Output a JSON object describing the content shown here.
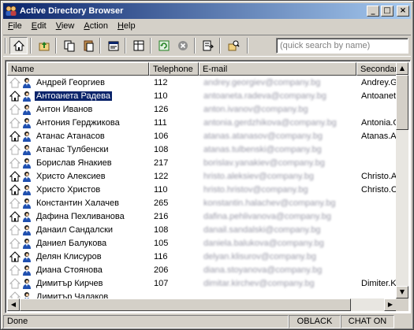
{
  "window": {
    "title": "Active Directory Browser"
  },
  "menu": [
    {
      "label": "File",
      "key": "F",
      "rest": "ile"
    },
    {
      "label": "Edit",
      "key": "E",
      "rest": "dit"
    },
    {
      "label": "View",
      "key": "V",
      "rest": "iew"
    },
    {
      "label": "Action",
      "key": "A",
      "rest": "ction"
    },
    {
      "label": "Help",
      "key": "H",
      "rest": "elp"
    }
  ],
  "toolbar": {
    "buttons": [
      "home-icon",
      "up-folder-icon",
      "copy-icon",
      "paste-icon",
      "properties-icon",
      "details-view-icon",
      "refresh-icon",
      "stop-icon",
      "export-icon",
      "filter-icon"
    ],
    "search_placeholder": "(quick search by name)"
  },
  "columns": {
    "name": "Name",
    "telephone": "Telephone",
    "email": "E-mail",
    "secondary": "Secondar"
  },
  "rows": [
    {
      "home": false,
      "name": "Андрей Георгиев",
      "tel": "112",
      "email": "andrey.georgiev@company.bg",
      "sec": "Andrey.G"
    },
    {
      "home": true,
      "name": "Антоанета Радева",
      "tel": "110",
      "email": "antoaneta.radeva@company.bg",
      "sec": "Antoaneta",
      "selected": true
    },
    {
      "home": false,
      "name": "Антон Иванов",
      "tel": "126",
      "email": "anton.ivanov@company.bg",
      "sec": ""
    },
    {
      "home": false,
      "name": "Антония Герджикова",
      "tel": "111",
      "email": "antonia.gerdzhikova@company.bg",
      "sec": "Antonia.G"
    },
    {
      "home": true,
      "name": "Атанас Атанасов",
      "tel": "106",
      "email": "atanas.atanasov@company.bg",
      "sec": "Atanas.A"
    },
    {
      "home": false,
      "name": "Атанас Тулбенски",
      "tel": "108",
      "email": "atanas.tulbenski@company.bg",
      "sec": ""
    },
    {
      "home": false,
      "name": "Борислав Янакиев",
      "tel": "217",
      "email": "borislav.yanakiev@company.bg",
      "sec": ""
    },
    {
      "home": true,
      "name": "Христо Алексиев",
      "tel": "122",
      "email": "hristo.aleksiev@company.bg",
      "sec": "Christo.Al"
    },
    {
      "home": true,
      "name": "Христо Христов",
      "tel": "110",
      "email": "hristo.hristov@company.bg",
      "sec": "Christo.Cl"
    },
    {
      "home": false,
      "name": "Константин Халачев",
      "tel": "265",
      "email": "konstantin.halachev@company.bg",
      "sec": ""
    },
    {
      "home": true,
      "name": "Дафина Пехливанова",
      "tel": "216",
      "email": "dafina.pehlivanova@company.bg",
      "sec": ""
    },
    {
      "home": false,
      "name": "Данаил Сандалски",
      "tel": "108",
      "email": "danail.sandalski@company.bg",
      "sec": ""
    },
    {
      "home": false,
      "name": "Даниел Балукова",
      "tel": "105",
      "email": "daniela.balukova@company.bg",
      "sec": ""
    },
    {
      "home": true,
      "name": "Делян Клисуров",
      "tel": "116",
      "email": "delyan.klisurov@company.bg",
      "sec": ""
    },
    {
      "home": false,
      "name": "Диана Стоянова",
      "tel": "206",
      "email": "diana.stoyanova@company.bg",
      "sec": ""
    },
    {
      "home": false,
      "name": "Димитър Кирчев",
      "tel": "107",
      "email": "dimitar.kirchev@company.bg",
      "sec": "Dimiter.Ki"
    },
    {
      "home": false,
      "name": "Димитър Чалаков",
      "tel": "",
      "email": "",
      "sec": ""
    }
  ],
  "status": {
    "left": "Done",
    "user": "OBLACK",
    "mode": "CHAT ON"
  }
}
